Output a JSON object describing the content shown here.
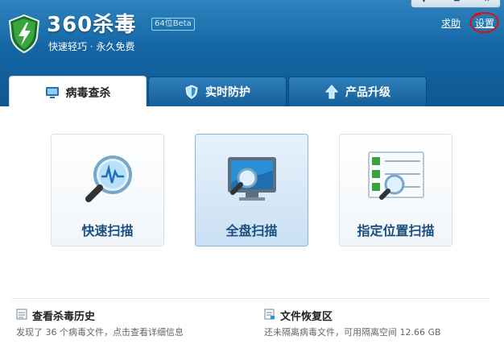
{
  "app": {
    "logo_text": "360杀毒",
    "badge": "64位Beta",
    "slogan": "快速轻巧 · 永久免费"
  },
  "top_links": {
    "help": "求助",
    "settings": "设置"
  },
  "tabs": [
    {
      "label": "病毒查杀",
      "icon": "monitor-icon",
      "active": true
    },
    {
      "label": "实时防护",
      "icon": "shield-icon",
      "active": false
    },
    {
      "label": "产品升级",
      "icon": "up-arrow-icon",
      "active": false
    }
  ],
  "scan_options": [
    {
      "label": "快速扫描",
      "icon": "magnifier-icon",
      "selected": false
    },
    {
      "label": "全盘扫描",
      "icon": "monitor-magnifier-icon",
      "selected": true
    },
    {
      "label": "指定位置扫描",
      "icon": "checklist-magnifier-icon",
      "selected": false
    }
  ],
  "footer": {
    "history": {
      "title": "查看杀毒历史",
      "desc": "发现了 36 个病毒文件，点击查看详细信息"
    },
    "restore": {
      "title": "文件恢复区",
      "desc": "还未隔离病毒文件，可用隔离空间 12.66 GB"
    }
  },
  "colors": {
    "header_blue": "#1466a4",
    "link_white": "#ffffff",
    "annotation_red": "#e01010",
    "card_label_blue": "#1b4e7e"
  }
}
